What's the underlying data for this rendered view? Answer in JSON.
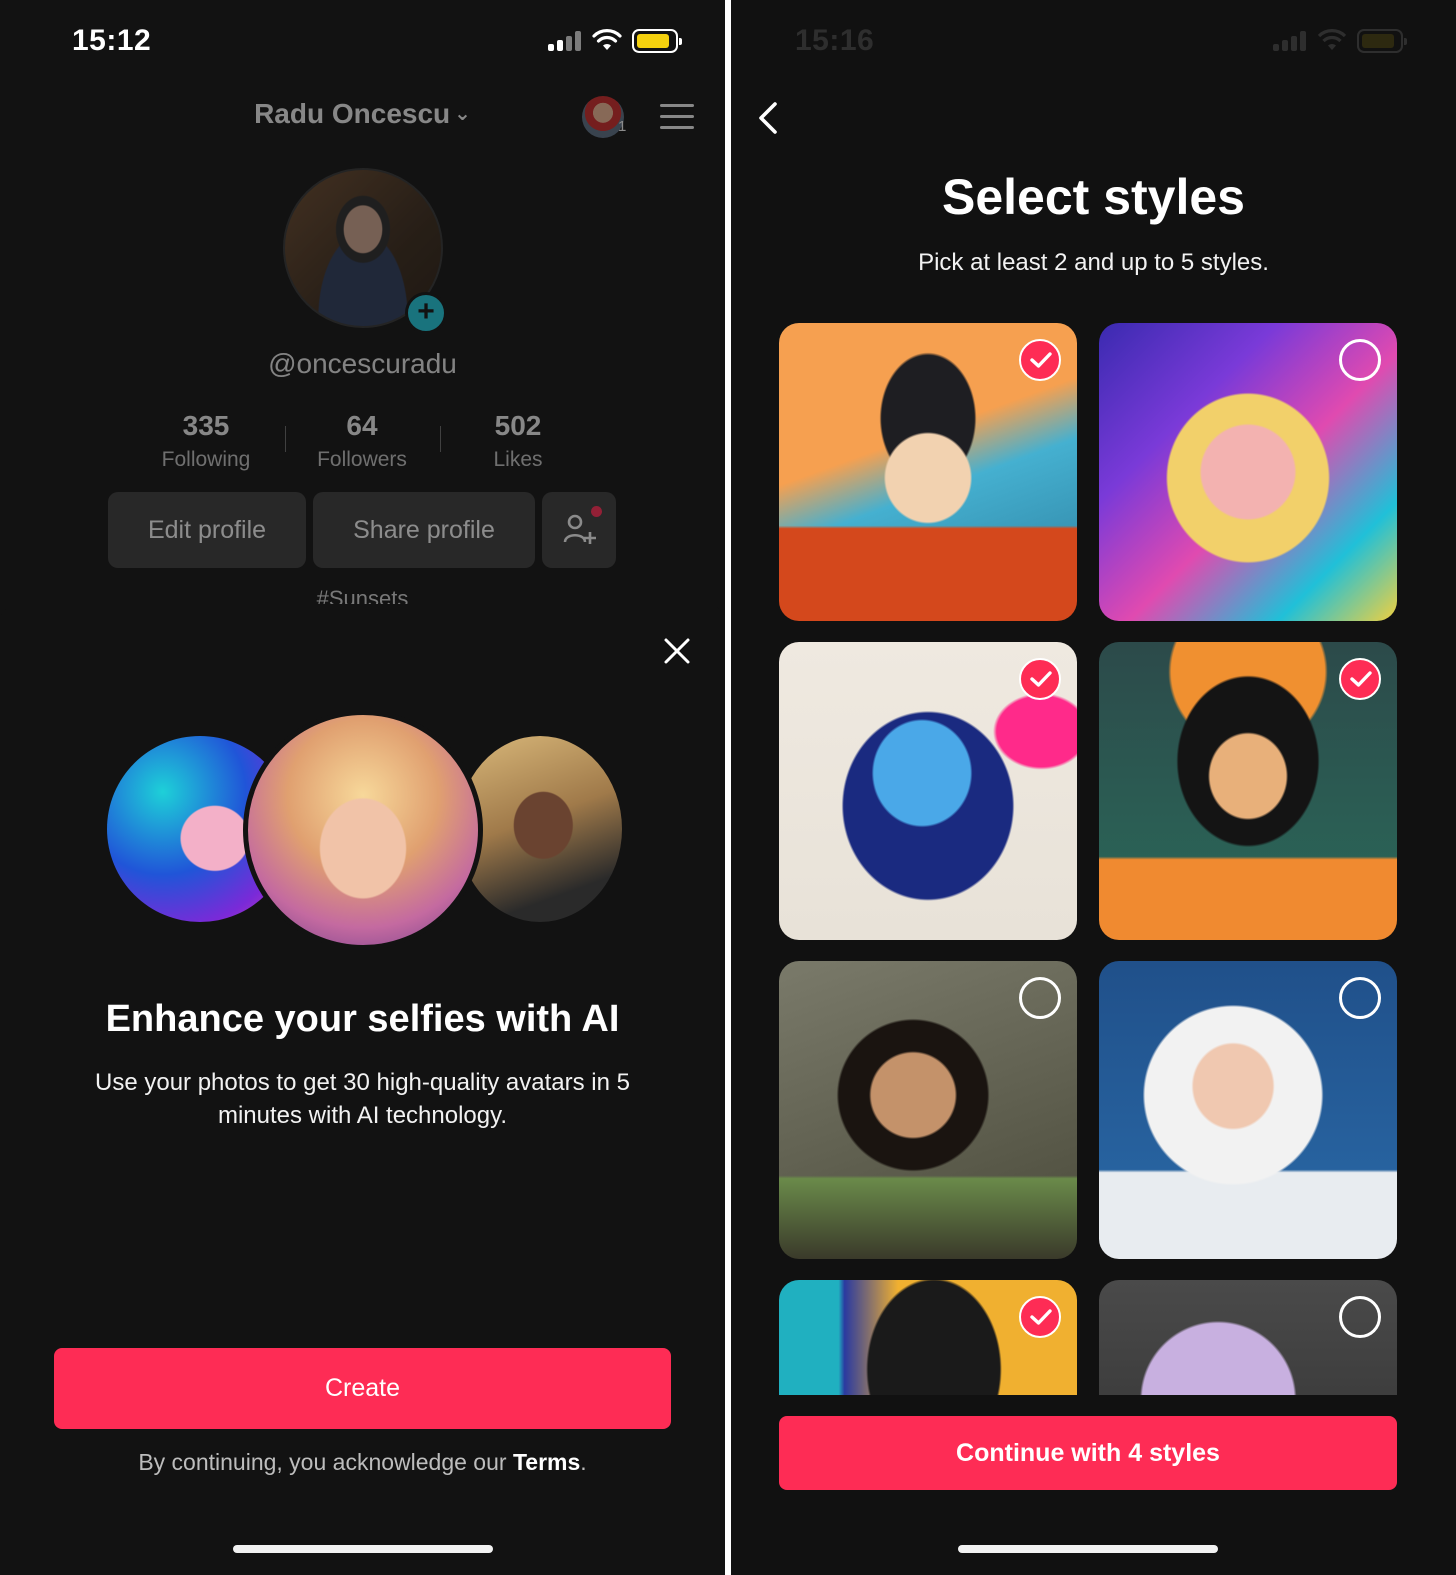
{
  "left": {
    "status": {
      "time": "15:12"
    },
    "profile": {
      "name": "Radu Oncescu",
      "chevron": "⌄",
      "notification_count": "1",
      "handle": "@oncescuradu",
      "stats": [
        {
          "value": "335",
          "label": "Following"
        },
        {
          "value": "64",
          "label": "Followers"
        },
        {
          "value": "502",
          "label": "Likes"
        }
      ],
      "edit_label": "Edit profile",
      "share_label": "Share profile",
      "playlist": "#Sunsets"
    },
    "sheet": {
      "title": "Enhance your selfies with AI",
      "description": "Use your photos to get 30 high-quality avatars in 5 minutes with AI technology.",
      "create_label": "Create",
      "terms_prefix": "By continuing, you acknowledge our ",
      "terms_link": "Terms",
      "terms_suffix": "."
    }
  },
  "right": {
    "status": {
      "time": "15:16"
    },
    "title": "Select styles",
    "subtitle": "Pick at least 2 and up to 5 styles.",
    "styles": [
      {
        "name": "mountain-illustration",
        "selected": true
      },
      {
        "name": "neon-glow",
        "selected": false
      },
      {
        "name": "watercolor",
        "selected": true
      },
      {
        "name": "floral-poster",
        "selected": true
      },
      {
        "name": "fantasy-armor",
        "selected": false
      },
      {
        "name": "astronaut",
        "selected": false
      },
      {
        "name": "pop-art",
        "selected": true
      },
      {
        "name": "cyber-portrait",
        "selected": false
      }
    ],
    "continue_label": "Continue with 4 styles"
  },
  "colors": {
    "accent": "#fe2c55",
    "background": "#121212",
    "teal": "#1fc3d6",
    "battery": "#f5d10e"
  }
}
